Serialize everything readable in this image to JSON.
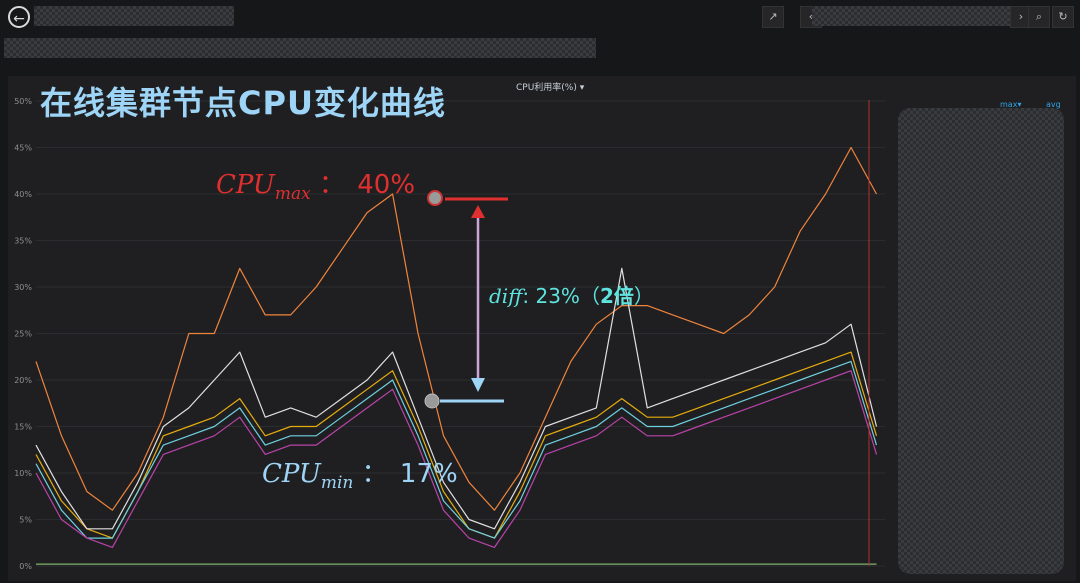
{
  "header": {
    "back_icon": "back-arrow-icon",
    "share_icon": "share-icon",
    "nav_prev_icon": "chevron-left-icon",
    "nav_next_icon": "chevron-right-icon",
    "zoom_icon": "zoom-out-icon",
    "refresh_icon": "refresh-icon"
  },
  "panel": {
    "title": "在线集群节点CPU变化曲线",
    "metric_title": "CPU利用率(%)",
    "legend_columns": [
      "max",
      "avg"
    ]
  },
  "annotations": {
    "max_label": "CPU",
    "max_sub": "max",
    "max_value": "40%",
    "min_label": "CPU",
    "min_sub": "min",
    "min_value": "17%",
    "diff_label": "diff",
    "diff_value": "23%（",
    "diff_bold": "2倍",
    "diff_close": "）",
    "colon": "：",
    "colon_diff": ":"
  },
  "colors": {
    "background": "#161719",
    "panel": "#1f1f21",
    "title": "#9ed4f6",
    "max_red": "#e02f2f",
    "min_blue": "#9ed4f6",
    "diff_teal": "#5ee3df",
    "grid": "#2b2c2f"
  },
  "chart_data": {
    "type": "line",
    "title": "CPU利用率(%)",
    "ylim": [
      0,
      50
    ],
    "y_ticks": [
      "0%",
      "5%",
      "10%",
      "15%",
      "20%",
      "25%",
      "30%",
      "35%",
      "40%",
      "45%",
      "50%"
    ],
    "x_index_range": [
      0,
      100
    ],
    "grid": true,
    "series": [
      {
        "color": "#ef843c",
        "x": [
          0,
          3,
          6,
          9,
          12,
          15,
          18,
          21,
          24,
          27,
          30,
          33,
          36,
          39,
          42,
          45,
          48,
          51,
          54,
          57,
          60,
          63,
          66,
          69,
          72,
          75,
          78,
          81,
          84,
          87,
          90,
          93,
          96,
          99
        ],
        "values": [
          22,
          14,
          8,
          6,
          10,
          16,
          25,
          25,
          32,
          27,
          27,
          30,
          34,
          38,
          40,
          25,
          14,
          9,
          6,
          10,
          16,
          22,
          26,
          28,
          28,
          27,
          26,
          25,
          27,
          30,
          36,
          40,
          45,
          40
        ]
      },
      {
        "color": "#e5ac0e",
        "x": [
          0,
          3,
          6,
          9,
          12,
          15,
          18,
          21,
          24,
          27,
          30,
          33,
          36,
          39,
          42,
          45,
          48,
          51,
          54,
          57,
          60,
          63,
          66,
          69,
          72,
          75,
          78,
          81,
          84,
          87,
          90,
          93,
          96,
          99
        ],
        "values": [
          12,
          7,
          4,
          3,
          8,
          14,
          15,
          16,
          18,
          14,
          15,
          15,
          17,
          19,
          21,
          15,
          8,
          4,
          3,
          8,
          14,
          15,
          16,
          18,
          16,
          16,
          17,
          18,
          19,
          20,
          21,
          22,
          23,
          14
        ]
      },
      {
        "color": "#6ed0e0",
        "x": [
          0,
          3,
          6,
          9,
          12,
          15,
          18,
          21,
          24,
          27,
          30,
          33,
          36,
          39,
          42,
          45,
          48,
          51,
          54,
          57,
          60,
          63,
          66,
          69,
          72,
          75,
          78,
          81,
          84,
          87,
          90,
          93,
          96,
          99
        ],
        "values": [
          11,
          6,
          3,
          3,
          8,
          13,
          14,
          15,
          17,
          13,
          14,
          14,
          16,
          18,
          20,
          14,
          7,
          4,
          3,
          7,
          13,
          14,
          15,
          17,
          15,
          15,
          16,
          17,
          18,
          19,
          20,
          21,
          22,
          13
        ]
      },
      {
        "color": "#ba43a9",
        "x": [
          0,
          3,
          6,
          9,
          12,
          15,
          18,
          21,
          24,
          27,
          30,
          33,
          36,
          39,
          42,
          45,
          48,
          51,
          54,
          57,
          60,
          63,
          66,
          69,
          72,
          75,
          78,
          81,
          84,
          87,
          90,
          93,
          96,
          99
        ],
        "values": [
          10,
          5,
          3,
          2,
          7,
          12,
          13,
          14,
          16,
          12,
          13,
          13,
          15,
          17,
          19,
          13,
          6,
          3,
          2,
          6,
          12,
          13,
          14,
          16,
          14,
          14,
          15,
          16,
          17,
          18,
          19,
          20,
          21,
          12
        ]
      },
      {
        "color": "#e0e0e0",
        "x": [
          0,
          3,
          6,
          9,
          12,
          15,
          18,
          21,
          24,
          27,
          30,
          33,
          36,
          39,
          42,
          45,
          48,
          51,
          54,
          57,
          60,
          63,
          66,
          69,
          72,
          75,
          78,
          81,
          84,
          87,
          90,
          93,
          96,
          99
        ],
        "values": [
          13,
          8,
          4,
          4,
          9,
          15,
          17,
          20,
          23,
          16,
          17,
          16,
          18,
          20,
          23,
          16,
          9,
          5,
          4,
          9,
          15,
          16,
          17,
          32,
          17,
          18,
          19,
          20,
          21,
          22,
          23,
          24,
          26,
          15
        ]
      },
      {
        "color": "#7eb26d",
        "x": [
          0,
          3,
          6,
          9,
          12,
          15,
          18,
          21,
          24,
          27,
          30,
          33,
          36,
          39,
          42,
          45,
          48,
          51,
          54,
          57,
          60,
          63,
          66,
          69,
          72,
          75,
          78,
          81,
          84,
          87,
          90,
          93,
          96,
          99
        ],
        "values": [
          0.2,
          0.2,
          0.2,
          0.2,
          0.2,
          0.2,
          0.2,
          0.2,
          0.2,
          0.2,
          0.2,
          0.2,
          0.2,
          0.2,
          0.2,
          0.2,
          0.2,
          0.2,
          0.2,
          0.2,
          0.2,
          0.2,
          0.2,
          0.2,
          0.2,
          0.2,
          0.2,
          0.2,
          0.2,
          0.2,
          0.2,
          0.2,
          0.2,
          0.2
        ]
      }
    ]
  }
}
